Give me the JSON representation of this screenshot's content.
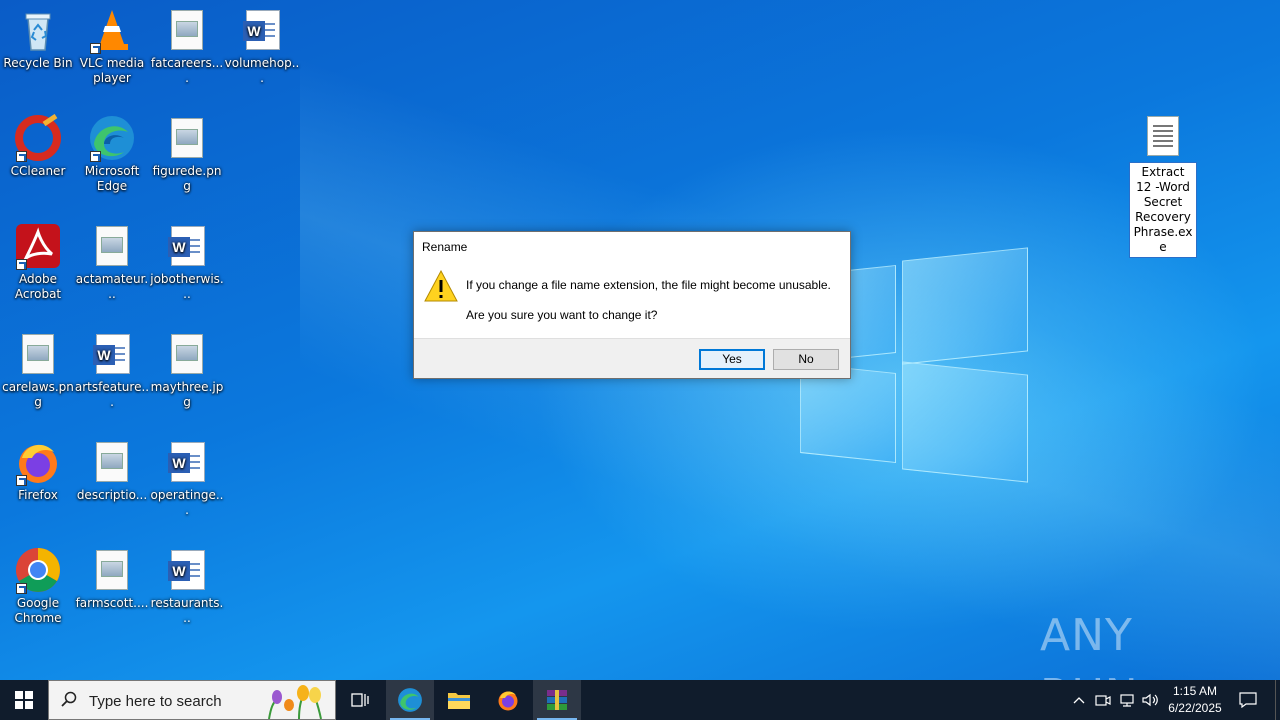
{
  "desktop": {
    "icons": [
      {
        "label": "Recycle Bin"
      },
      {
        "label": "VLC media player"
      },
      {
        "label": "fatcareers...."
      },
      {
        "label": "volumehop..."
      },
      {
        "label": "CCleaner"
      },
      {
        "label": "Microsoft Edge"
      },
      {
        "label": "figurede.png"
      },
      {
        "label": "Adobe Acrobat"
      },
      {
        "label": "actamateur..."
      },
      {
        "label": "jobotherwis..."
      },
      {
        "label": "carelaws.png"
      },
      {
        "label": "artsfeature..."
      },
      {
        "label": "maythree.jpg"
      },
      {
        "label": "Firefox"
      },
      {
        "label": "descriptio..."
      },
      {
        "label": "operatinge..."
      },
      {
        "label": "Google Chrome"
      },
      {
        "label": "farmscott...."
      },
      {
        "label": "restaurants..."
      }
    ],
    "selected_file": {
      "label": "Extract 12 -Word Secret Recovery Phrase.exe"
    }
  },
  "dialog": {
    "title": "Rename",
    "message": "If you change a file name extension, the file might become unusable.",
    "question": "Are you sure you want to change it?",
    "yes_label": "Yes",
    "no_label": "No"
  },
  "watermark": {
    "text": "ANY RUN"
  },
  "taskbar": {
    "search_placeholder": "Type here to search",
    "time": "1:15 AM",
    "date": "6/22/2025"
  },
  "colors": {
    "accent": "#0078d7",
    "taskbar": "#101c2c"
  }
}
